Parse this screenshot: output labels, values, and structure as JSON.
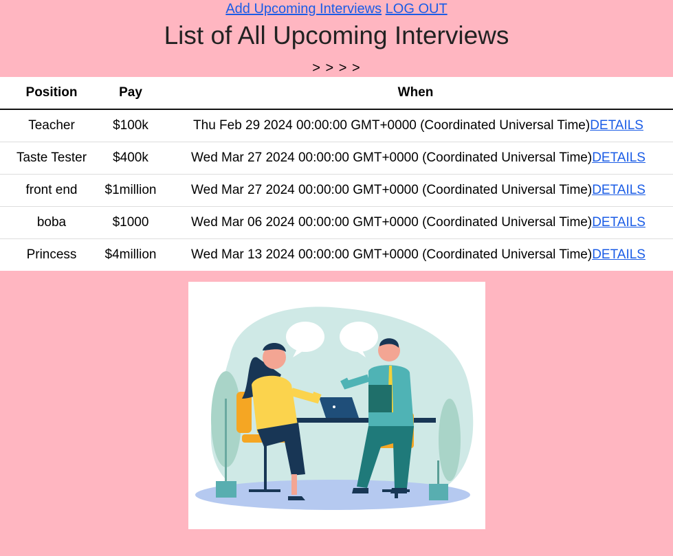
{
  "nav": {
    "add_label": "Add Upcoming Interviews",
    "logout_label": "LOG OUT"
  },
  "page_title": "List of All Upcoming Interviews",
  "arrows": "> > > >",
  "table": {
    "headers": {
      "position": "Position",
      "pay": "Pay",
      "when": "When"
    },
    "details_label": "DETAILS",
    "rows": [
      {
        "position": "Teacher",
        "pay": "$100k",
        "when": "Thu Feb 29 2024 00:00:00 GMT+0000 (Coordinated Universal Time)"
      },
      {
        "position": "Taste Tester",
        "pay": "$400k",
        "when": "Wed Mar 27 2024 00:00:00 GMT+0000 (Coordinated Universal Time)"
      },
      {
        "position": "front end",
        "pay": "$1million",
        "when": "Wed Mar 27 2024 00:00:00 GMT+0000 (Coordinated Universal Time)"
      },
      {
        "position": "boba",
        "pay": "$1000",
        "when": "Wed Mar 06 2024 00:00:00 GMT+0000 (Coordinated Universal Time)"
      },
      {
        "position": "Princess",
        "pay": "$4million",
        "when": "Wed Mar 13 2024 00:00:00 GMT+0000 (Coordinated Universal Time)"
      }
    ]
  },
  "illustration": {
    "icon": "interview-illustration",
    "background_color": "#ffb6c1"
  }
}
